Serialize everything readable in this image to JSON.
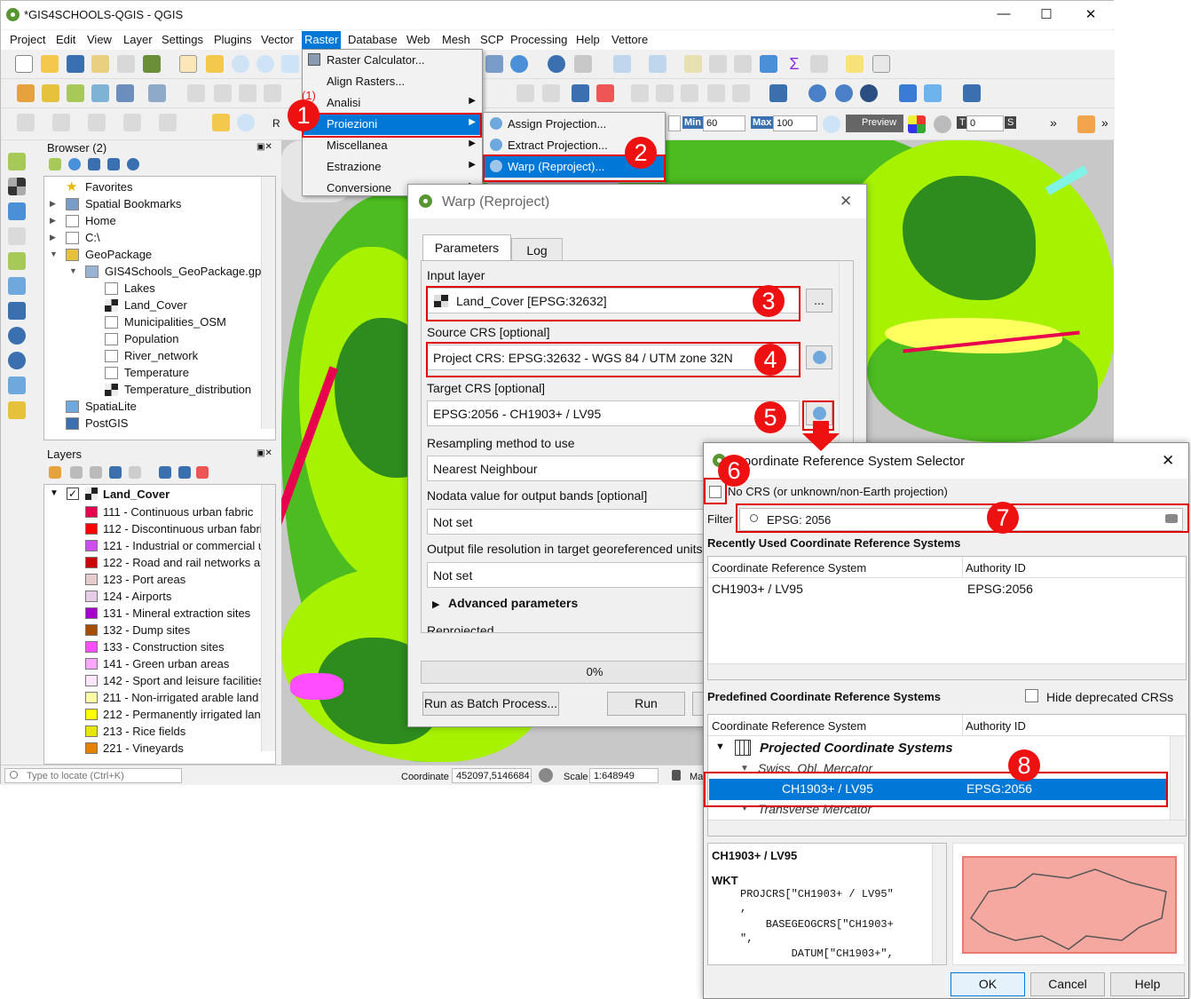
{
  "window": {
    "title": "*GIS4SCHOOLS-QGIS - QGIS",
    "minimize": "—",
    "maximize": "☐",
    "close": "✕"
  },
  "menubar": [
    "Project",
    "Edit",
    "View",
    "Layer",
    "Settings",
    "Plugins",
    "Vector",
    "Raster",
    "Database",
    "Web",
    "Mesh",
    "SCP",
    "Processing",
    "Help",
    "Vettore"
  ],
  "raster_menu": {
    "items": [
      {
        "label": "Raster Calculator...",
        "icon": "calculator-icon"
      },
      {
        "label": "Align Rasters...",
        "icon": ""
      },
      {
        "label": "Analisi",
        "submenu": true
      },
      {
        "label": "Proiezioni",
        "submenu": true,
        "highlighted": true
      },
      {
        "label": "Miscellanea",
        "submenu": true
      },
      {
        "label": "Estrazione",
        "submenu": true
      },
      {
        "label": "Conversione",
        "submenu": true
      }
    ],
    "submenu_items": [
      {
        "label": "Assign Projection...",
        "icon": "globe-icon"
      },
      {
        "label": "Extract Projection...",
        "icon": "globe-icon"
      },
      {
        "label": "Warp (Reproject)...",
        "icon": "warp-icon",
        "highlighted": true
      }
    ],
    "stray_label": "(1)"
  },
  "toolbar3": {
    "min_label": "Min",
    "min_value": "60",
    "max_label": "Max",
    "max_value": "100",
    "preview": "Preview",
    "t_label": "T",
    "t_value": "0",
    "s_label": "S",
    "more": "»"
  },
  "browser": {
    "title": "Browser (2)",
    "items": [
      {
        "label": "Favorites",
        "icon": "star-icon",
        "indent": 0,
        "expander": ""
      },
      {
        "label": "Spatial Bookmarks",
        "icon": "bookmark-icon",
        "indent": 0,
        "expander": "▶"
      },
      {
        "label": "Home",
        "icon": "folder-icon",
        "indent": 0,
        "expander": "▶"
      },
      {
        "label": "C:\\",
        "icon": "folder-icon",
        "indent": 0,
        "expander": "▶"
      },
      {
        "label": "GeoPackage",
        "icon": "geopackage-icon",
        "indent": 0,
        "expander": "▼"
      },
      {
        "label": "GIS4Schools_GeoPackage.gpkg",
        "icon": "database-icon",
        "indent": 1,
        "expander": "▼"
      },
      {
        "label": "Lakes",
        "icon": "polygon-icon",
        "indent": 2,
        "expander": ""
      },
      {
        "label": "Land_Cover",
        "icon": "raster-icon",
        "indent": 2,
        "expander": ""
      },
      {
        "label": "Municipalities_OSM",
        "icon": "polygon-icon",
        "indent": 2,
        "expander": ""
      },
      {
        "label": "Population",
        "icon": "table-icon",
        "indent": 2,
        "expander": ""
      },
      {
        "label": "River_network",
        "icon": "line-icon",
        "indent": 2,
        "expander": ""
      },
      {
        "label": "Temperature",
        "icon": "point-icon",
        "indent": 2,
        "expander": ""
      },
      {
        "label": "Temperature_distribution",
        "icon": "raster-icon",
        "indent": 2,
        "expander": ""
      },
      {
        "label": "SpatiaLite",
        "icon": "spatialite-icon",
        "indent": 0,
        "expander": ""
      },
      {
        "label": "PostGIS",
        "icon": "postgis-icon",
        "indent": 0,
        "expander": ""
      }
    ]
  },
  "layers": {
    "title": "Layers",
    "root": "Land_Cover",
    "entries": [
      {
        "label": "111 - Continuous urban fabric",
        "color": "#e6004d"
      },
      {
        "label": "112 - Discontinuous urban fabri",
        "color": "#ff0000"
      },
      {
        "label": "121 - Industrial or commercial u",
        "color": "#cc4df2"
      },
      {
        "label": "122 - Road and rail networks an",
        "color": "#cc0000"
      },
      {
        "label": "123 - Port areas",
        "color": "#e6cccc"
      },
      {
        "label": "124 - Airports",
        "color": "#e6cce6"
      },
      {
        "label": "131 - Mineral extraction sites",
        "color": "#a600cc"
      },
      {
        "label": "132 - Dump sites",
        "color": "#a64d00"
      },
      {
        "label": "133 - Construction sites",
        "color": "#ff4dff"
      },
      {
        "label": "141 - Green urban areas",
        "color": "#ffa6ff"
      },
      {
        "label": "142 - Sport and leisure facilities",
        "color": "#ffe6ff"
      },
      {
        "label": "211 - Non-irrigated arable land",
        "color": "#ffffa8"
      },
      {
        "label": "212 - Permanently irrigated land",
        "color": "#ffff00"
      },
      {
        "label": "213 - Rice fields",
        "color": "#e6e600"
      },
      {
        "label": "221 - Vineyards",
        "color": "#e68000"
      }
    ]
  },
  "statusbar": {
    "locate_placeholder": "Type to locate (Ctrl+K)",
    "coordinate_label": "Coordinate",
    "coordinate_value": "452097,5146684",
    "scale_label": "Scale",
    "scale_value": "1:648949",
    "magnifier_label": "Ma"
  },
  "warp": {
    "title": "Warp (Reproject)",
    "tabs": [
      "Parameters",
      "Log"
    ],
    "input_layer_label": "Input layer",
    "input_layer_value": "Land_Cover [EPSG:32632]",
    "source_crs_label": "Source CRS [optional]",
    "source_crs_value": "Project CRS: EPSG:32632 - WGS 84 / UTM zone 32N",
    "target_crs_label": "Target CRS [optional]",
    "target_crs_value": "EPSG:2056 - CH1903+ / LV95",
    "resampling_label": "Resampling method to use",
    "resampling_value": "Nearest Neighbour",
    "nodata_label": "Nodata value for output bands [optional]",
    "nodata_value": "Not set",
    "resolution_label": "Output file resolution in target georeferenced units",
    "resolution_value": "Not set",
    "advanced": "Advanced parameters",
    "reprojected": "Reprojected",
    "progress": "0%",
    "batch_button": "Run as Batch Process...",
    "run_button": "Run",
    "ellipsis": "..."
  },
  "crs": {
    "title": "Coordinate Reference System Selector",
    "no_crs_label": "No CRS (or unknown/non-Earth projection)",
    "filter_label": "Filter",
    "filter_value": "EPSG: 2056",
    "recent_title": "Recently Used Coordinate Reference Systems",
    "col_crs": "Coordinate Reference System",
    "col_auth": "Authority ID",
    "recent_rows": [
      {
        "name": "CH1903+ / LV95",
        "auth": "EPSG:2056"
      }
    ],
    "predefined_title": "Predefined Coordinate Reference Systems",
    "hide_deprecated": "Hide deprecated CRSs",
    "tree": {
      "group": "Projected Coordinate Systems",
      "sub1": "Swiss. Obl. Mercator",
      "selected_name": "CH1903+ / LV95",
      "selected_auth": "EPSG:2056",
      "sub2": "Transverse Mercator"
    },
    "details_name": "CH1903+ / LV95",
    "wkt_label": "WKT",
    "wkt_lines": [
      "PROJCRS[\"CH1903+ / LV95\"",
      ",",
      "    BASEGEOGCRS[\"CH1903+",
      "\",",
      "        DATUM[\"CH1903+\","
    ],
    "ok": "OK",
    "cancel": "Cancel",
    "help": "Help"
  },
  "badges": [
    "1",
    "2",
    "3",
    "4",
    "5",
    "6",
    "7",
    "8"
  ],
  "colors": {
    "accent": "#0078d7",
    "annotation_red": "#e11111",
    "qgis_green": "#589632"
  }
}
